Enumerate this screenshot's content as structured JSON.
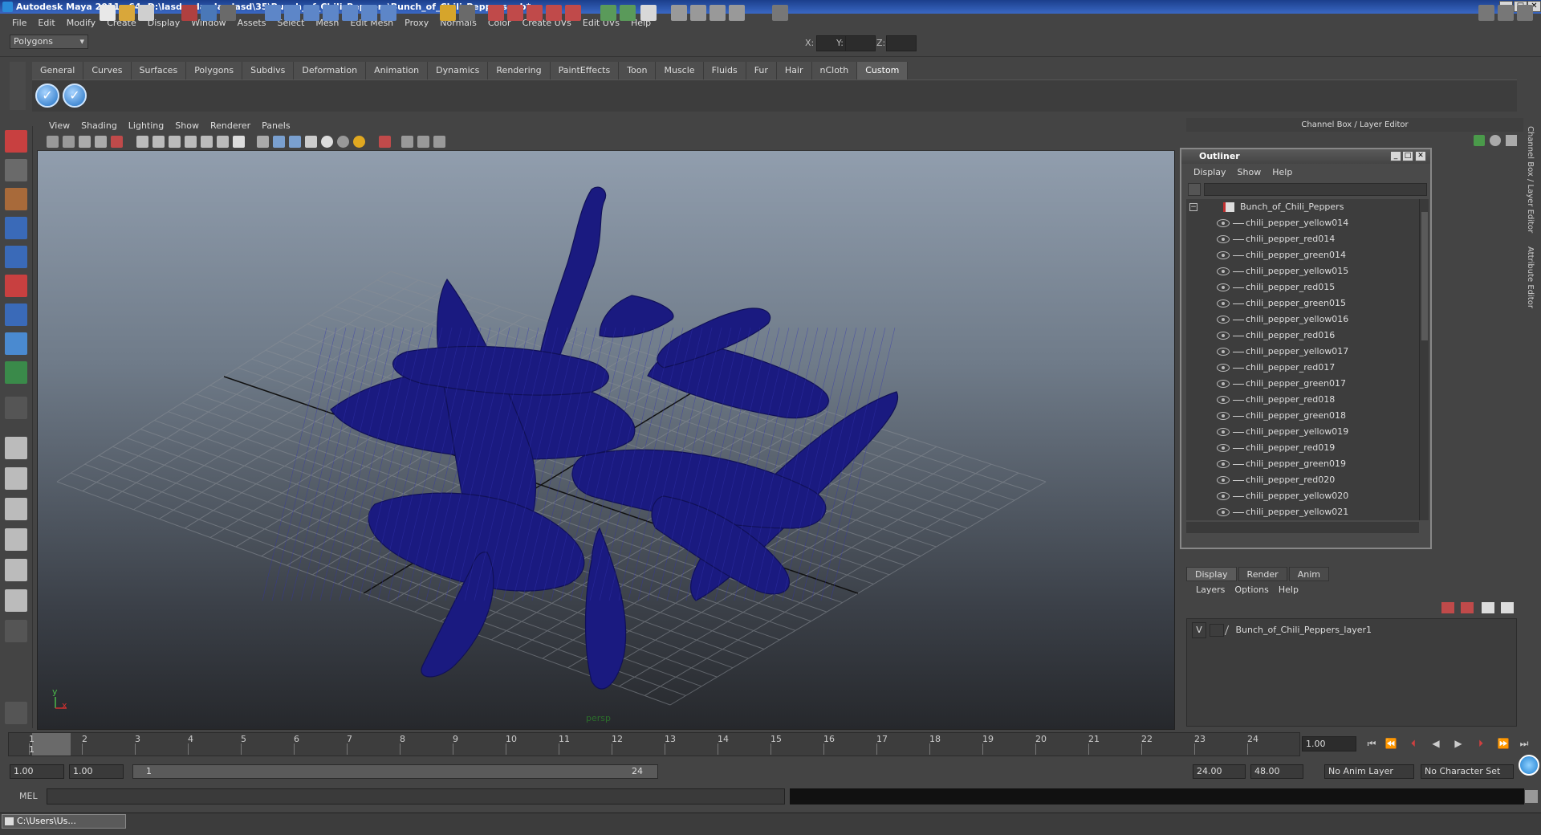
{
  "window": {
    "title": "Autodesk Maya 2011 x64: D:\\lasdasdasdasdasd\\35\\Bunch_of_Chili_Peppers\\Bunch_of_Chili_Peppers.mb*"
  },
  "menubar": [
    "File",
    "Edit",
    "Modify",
    "Create",
    "Display",
    "Window",
    "Assets",
    "Select",
    "Mesh",
    "Edit Mesh",
    "Proxy",
    "Normals",
    "Color",
    "Create UVs",
    "Edit UVs",
    "Help"
  ],
  "statusline": {
    "mode": "Polygons",
    "x_label": "X:",
    "y_label": "Y:",
    "z_label": "Z:"
  },
  "shelf": {
    "tabs": [
      "General",
      "Curves",
      "Surfaces",
      "Polygons",
      "Subdivs",
      "Deformation",
      "Animation",
      "Dynamics",
      "Rendering",
      "PaintEffects",
      "Toon",
      "Muscle",
      "Fluids",
      "Fur",
      "Hair",
      "nCloth",
      "Custom"
    ],
    "active_tab": "Custom"
  },
  "viewport": {
    "menu": [
      "View",
      "Shading",
      "Lighting",
      "Show",
      "Renderer",
      "Panels"
    ],
    "camera_label": "persp",
    "axis_y": "y",
    "axis_x": "x",
    "wire_color": "#1a1a80"
  },
  "channelbox": {
    "title": "Channel Box / Layer Editor",
    "side_tabs": [
      "Channel Box / Layer Editor",
      "Attribute Editor"
    ]
  },
  "outliner": {
    "title": "Outliner",
    "menu": [
      "Display",
      "Show",
      "Help"
    ],
    "root": "Bunch_of_Chili_Peppers",
    "items": [
      "chili_pepper_yellow014",
      "chili_pepper_red014",
      "chili_pepper_green014",
      "chili_pepper_yellow015",
      "chili_pepper_red015",
      "chili_pepper_green015",
      "chili_pepper_yellow016",
      "chili_pepper_red016",
      "chili_pepper_yellow017",
      "chili_pepper_red017",
      "chili_pepper_green017",
      "chili_pepper_red018",
      "chili_pepper_green018",
      "chili_pepper_yellow019",
      "chili_pepper_red019",
      "chili_pepper_green019",
      "chili_pepper_red020",
      "chili_pepper_yellow020",
      "chili_pepper_yellow021"
    ]
  },
  "layers": {
    "tabs": [
      "Display",
      "Render",
      "Anim"
    ],
    "active_tab": "Display",
    "menu": [
      "Layers",
      "Options",
      "Help"
    ],
    "layer": {
      "visible": "V",
      "name": "Bunch_of_Chili_Peppers_layer1"
    }
  },
  "timeline": {
    "ticks": [
      "1",
      "2",
      "3",
      "4",
      "5",
      "6",
      "7",
      "8",
      "9",
      "10",
      "11",
      "12",
      "13",
      "14",
      "15",
      "16",
      "17",
      "18",
      "19",
      "20",
      "21",
      "22",
      "23",
      "24"
    ],
    "current_marker": "1",
    "current_frame": "1.00"
  },
  "range": {
    "start": "1.00",
    "playback_start": "1.00",
    "slider_start": "1",
    "slider_end": "24",
    "playback_end": "24.00",
    "end": "48.00",
    "anim_layer": "No Anim Layer",
    "character_set": "No Character Set"
  },
  "command": {
    "label": "MEL"
  },
  "taskbar": {
    "item": "C:\\Users\\Us..."
  }
}
